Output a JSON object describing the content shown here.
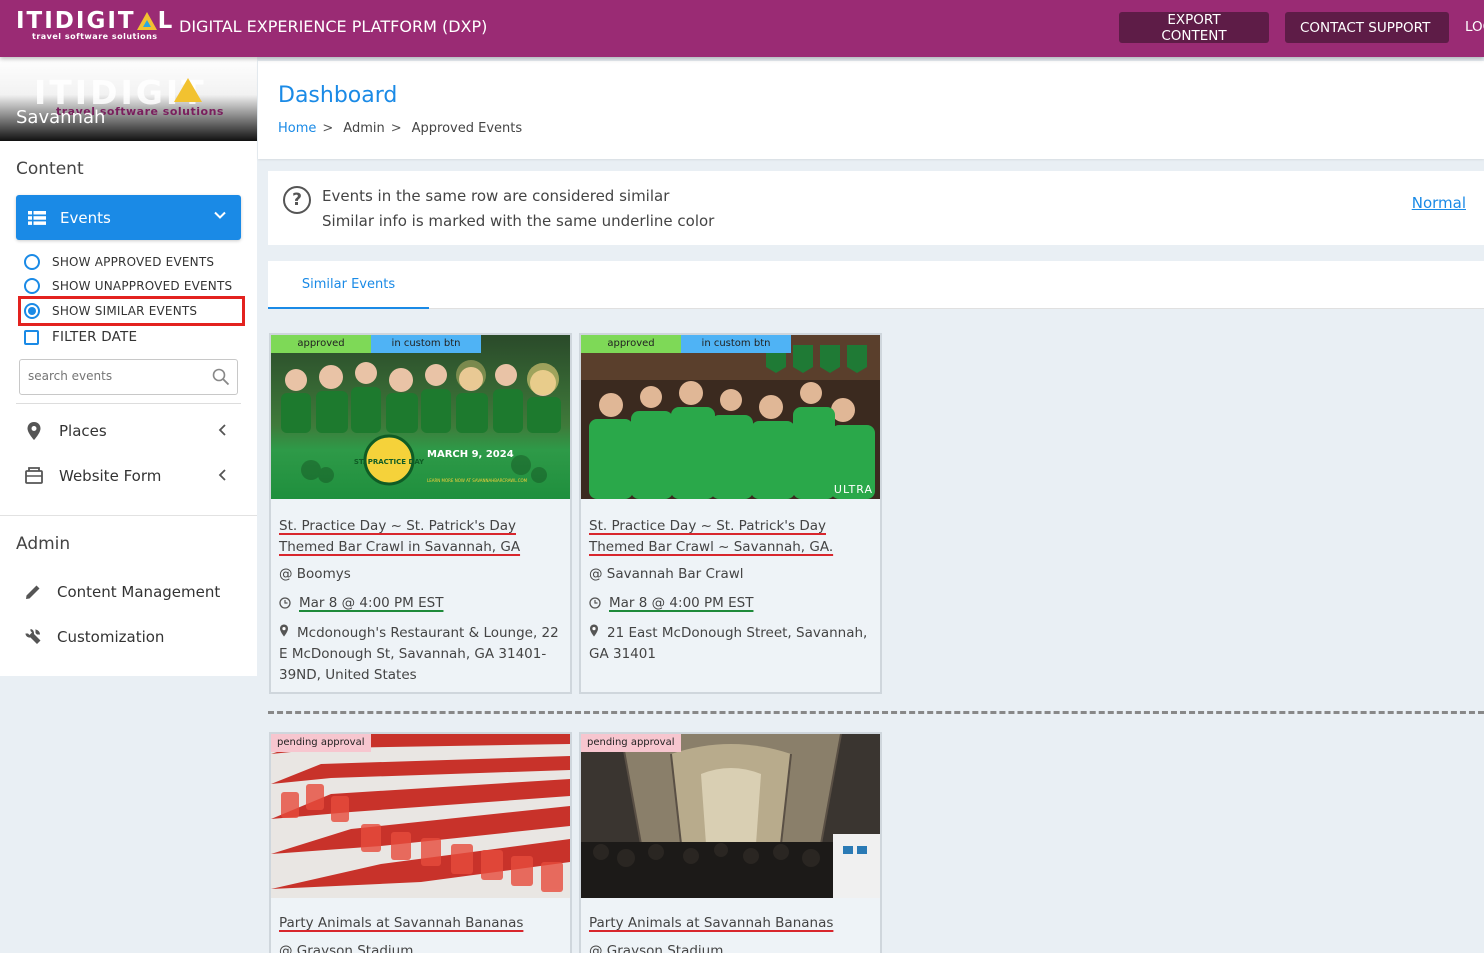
{
  "topbar": {
    "logo_text": "ITIDIGITAL",
    "logo_sub": "travel software solutions",
    "app_title": "DIGITAL EXPERIENCE PLATFORM (DXP)",
    "export_label": "EXPORT CONTENT",
    "contact_label": "CONTACT SUPPORT",
    "logout_label": "LOGOUT",
    "bg_color": "#9a2b74"
  },
  "sidebar": {
    "city": "Savannah",
    "content_label": "Content",
    "events_label": "Events",
    "radios": [
      {
        "label": "SHOW APPROVED EVENTS",
        "checked": false
      },
      {
        "label": "SHOW UNAPPROVED EVENTS",
        "checked": false
      },
      {
        "label": "SHOW SIMILAR EVENTS",
        "checked": true
      }
    ],
    "filter_date_label": "FILTER DATE",
    "search_placeholder": "search events",
    "places_label": "Places",
    "website_form_label": "Website Form",
    "admin_label": "Admin",
    "content_mgmt_label": "Content Management",
    "customization_label": "Customization",
    "accent_color": "#1a8ae6"
  },
  "main": {
    "page_title": "Dashboard",
    "breadcrumbs": [
      "Home",
      "Admin",
      "Approved Events"
    ],
    "info_line1": "Events in the same row are considered similar",
    "info_line2": "Similar info is marked with the same underline color",
    "normal_link": "Normal",
    "tab_label": "Similar Events"
  },
  "events": [
    {
      "status": "approved",
      "extra_badge": "in custom btn",
      "title": "St. Practice Day ~ St. Patrick's Day Themed Bar Crawl in Savannah, GA",
      "venue": "@ Boomys",
      "date": "Mar 8 @ 4:00 PM EST",
      "address": "Mcdonough's Restaurant & Lounge, 22 E McDonough St, Savannah, GA 31401-39ND, United States",
      "poster_date": "MARCH 9, 2024",
      "poster_sub": "LEARN MORE NOW AT SAVANNAHBARCRAWL.COM",
      "poster_logo": "ST. PRACTICE DAY"
    },
    {
      "status": "approved",
      "extra_badge": "in custom btn",
      "title": "St. Practice Day ~ St. Patrick's Day Themed Bar Crawl ~ Savannah, GA.",
      "venue": "@ Savannah Bar Crawl",
      "date": "Mar 8 @ 4:00 PM EST",
      "address": "21 East McDonough Street, Savannah, GA 31401",
      "watermark": "ULTRA"
    },
    {
      "status": "pending approval",
      "title": "Party Animals at Savannah Bananas",
      "venue": "@ Grayson Stadium"
    },
    {
      "status": "pending approval",
      "title": "Party Animals at Savannah Bananas",
      "venue": "@ Grayson Stadium"
    }
  ]
}
